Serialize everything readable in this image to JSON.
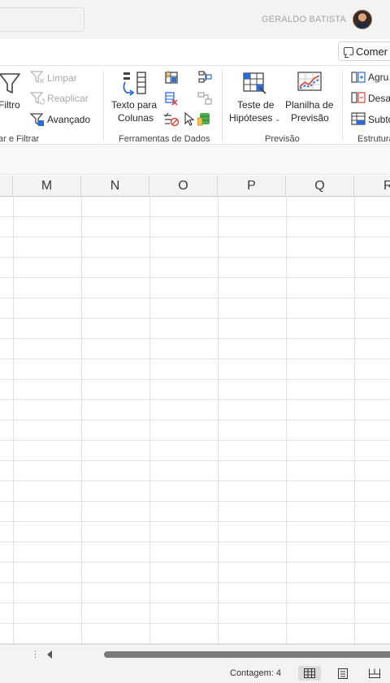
{
  "titlebar": {
    "user_name": "GERALDO BATISTA"
  },
  "comments_button": {
    "label": "Comer"
  },
  "ribbon": {
    "sort_filter": {
      "filter_label": "Filtro",
      "clear_label": "Limpar",
      "reapply_label": "Reaplicar",
      "advanced_label": "Avançado",
      "group_label": "ar e Filtrar"
    },
    "data_tools": {
      "text_to_columns_line1": "Texto para",
      "text_to_columns_line2": "Colunas",
      "group_label": "Ferramentas de Dados"
    },
    "forecast": {
      "what_if_line1": "Teste de",
      "what_if_line2": "Hipóteses",
      "forecast_sheet_line1": "Planilha de",
      "forecast_sheet_line2": "Previsão",
      "group_label": "Previsão"
    },
    "outline": {
      "group_label": "Agru",
      "ungroup_label": "Desa",
      "subtotal_label": "Subto",
      "section_label": "Estrutura"
    }
  },
  "columns": [
    "M",
    "N",
    "O",
    "P",
    "Q",
    "R"
  ],
  "status": {
    "count": "Contagem: 4"
  },
  "colors": {
    "accent_blue": "#2b6cd4",
    "grid_line": "#e2e2e2",
    "scroll_thumb": "#7a7a7a"
  }
}
